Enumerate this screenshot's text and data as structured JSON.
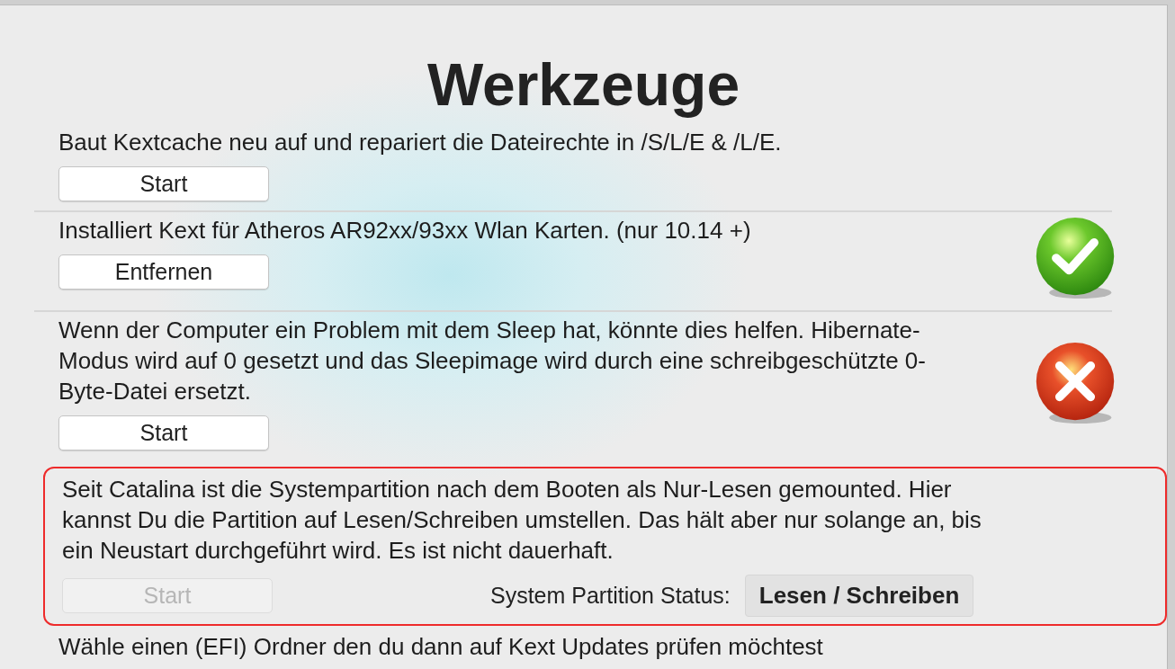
{
  "title": "Werkzeuge",
  "sections": [
    {
      "kind": "plain",
      "description": "Baut Kextcache neu auf und repariert die Dateirechte in /S/L/E & /L/E.",
      "button": {
        "label": "Start",
        "disabled": false
      },
      "highlighted": false
    },
    {
      "kind": "check",
      "description": "Installiert Kext für Atheros AR92xx/93xx Wlan Karten. (nur 10.14 +)",
      "button": {
        "label": "Entfernen",
        "disabled": false
      },
      "highlighted": false
    },
    {
      "kind": "cross",
      "description": "Wenn der Computer ein Problem mit dem Sleep hat, könnte dies helfen. Hibernate-Modus wird auf 0 gesetzt und das Sleepimage wird durch eine schreibgeschützte 0-Byte-Datei ersetzt.",
      "button": {
        "label": "Start",
        "disabled": false
      },
      "highlighted": false
    },
    {
      "kind": "plain",
      "description": "Seit Catalina ist die Systempartition nach dem Booten als Nur-Lesen gemounted. Hier kannst Du die Partition auf Lesen/Schreiben umstellen. Das hält aber nur solange an, bis ein Neustart durchgeführt wird. Es ist nicht dauerhaft.",
      "button": {
        "label": "Start",
        "disabled": true
      },
      "partition_status": {
        "label": "System Partition Status:",
        "value": "Lesen / Schreiben"
      },
      "highlighted": true
    },
    {
      "kind": "plain",
      "description": "Wähle einen (EFI) Ordner den du dann auf Kext Updates prüfen möchtest",
      "highlighted": false
    }
  ]
}
